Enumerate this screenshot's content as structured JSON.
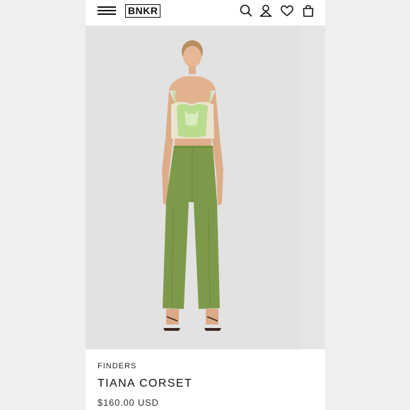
{
  "header": {
    "menu_icon": "hamburger-menu-icon",
    "logo_text": "BNKR",
    "icons": [
      "search-icon",
      "account-icon",
      "wishlist-heart-icon",
      "shopping-bag-icon"
    ]
  },
  "product": {
    "brand": "FINDERS",
    "name": "TIANA CORSET",
    "price": "$160.00 USD",
    "image": "product-photo-model-green-corset-and-pants"
  },
  "colors": {
    "background": "#efefef",
    "page": "#ffffff",
    "photo_bg": "#e2e2e2",
    "pants_green": "#7d9a4a",
    "corset_green": "#b9dc8f",
    "corset_cream": "#ebe4d0"
  }
}
